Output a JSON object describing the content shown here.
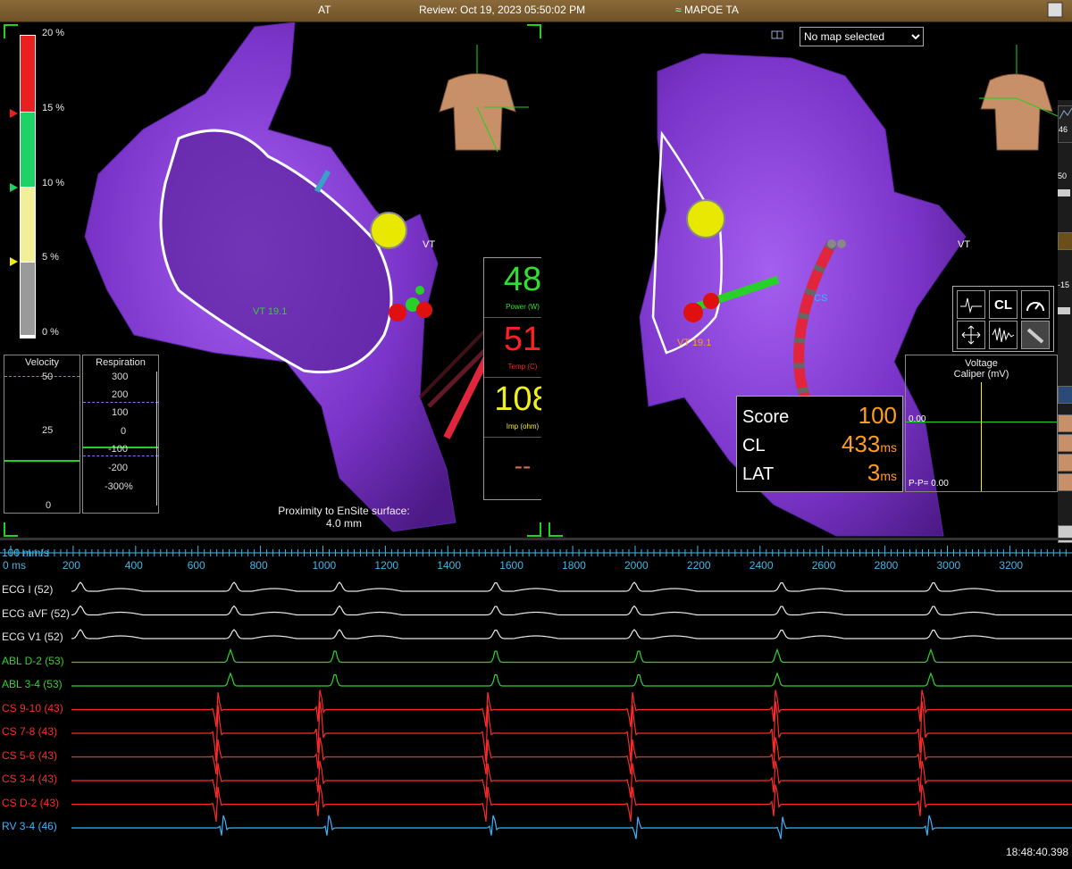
{
  "titlebar": {
    "left": "AT",
    "center": "Review: Oct 19, 2023 05:50:02 PM",
    "right": "MAPOE TA"
  },
  "map_selector": {
    "value": "No map selected",
    "options": [
      "No map selected"
    ]
  },
  "contact_scale": {
    "labels": [
      "20 %",
      "15 %",
      "10 %",
      "5 %",
      "0 %"
    ]
  },
  "velocity": {
    "title": "Velocity",
    "ticks": [
      "50",
      "25",
      "0"
    ]
  },
  "respiration": {
    "title": "Respiration",
    "ticks": [
      "300",
      "200",
      "100",
      "0",
      "-100",
      "-200",
      "-300%"
    ]
  },
  "map_left": {
    "label_vt": "VT",
    "label_vt19": "VT 19.1"
  },
  "map_right": {
    "label_vt": "VT",
    "label_vt19": "VT 19.1",
    "label_cs": "CS"
  },
  "ablation": {
    "power": {
      "value": "48",
      "label": "Power (W)"
    },
    "temp": {
      "value": "51",
      "label": "Temp (C)"
    },
    "imp": {
      "value": "108",
      "label": "Imp (ohm)"
    },
    "extra": "--"
  },
  "proximity": {
    "line1": "Proximity to EnSite surface:",
    "line2": "4.0 mm"
  },
  "score_panel": {
    "score_label": "Score",
    "score_value": "100",
    "cl_label": "CL",
    "cl_value": "433",
    "cl_unit": "ms",
    "lat_label": "LAT",
    "lat_value": "3",
    "lat_unit": "ms"
  },
  "voltage_panel": {
    "title": "Voltage",
    "subtitle": "Caliper (mV)",
    "zero": "0.00",
    "pp": "P-P= 0.00"
  },
  "tool_icons": {
    "cl": "CL"
  },
  "side_panel": {
    "val1": "46",
    "val2": "50",
    "val3": "-15"
  },
  "timeline": {
    "speed": "100 mm/s",
    "zero": "0 ms",
    "ticks": [
      "200",
      "400",
      "600",
      "800",
      "1000",
      "1200",
      "1400",
      "1600",
      "1800",
      "2000",
      "2200",
      "2400",
      "2600",
      "2800",
      "3000",
      "3200"
    ]
  },
  "traces": [
    {
      "label": "ECG I (52)",
      "color": "#e8e8e8"
    },
    {
      "label": "ECG aVF (52)",
      "color": "#e8e8e8"
    },
    {
      "label": "ECG V1 (52)",
      "color": "#e8e8e8"
    },
    {
      "label": "ABL  D-2 (53)",
      "color": "#2fd22f"
    },
    {
      "label": "ABL  3-4 (53)",
      "color": "#2fd22f"
    },
    {
      "label": "CS  9-10 (43)",
      "color": "#ff2a2a"
    },
    {
      "label": "CS  7-8 (43)",
      "color": "#ff2a2a"
    },
    {
      "label": "CS  5-6 (43)",
      "color": "#ff2a2a"
    },
    {
      "label": "CS  3-4 (43)",
      "color": "#ff2a2a"
    },
    {
      "label": "CS  D-2 (43)",
      "color": "#ff2a2a"
    },
    {
      "label": "RV  3-4 (46)",
      "color": "#3ab4ff"
    }
  ],
  "clock": "18:48:40.398",
  "colors": {
    "chamber": "#8a3fd6",
    "accent_green": "#1ed21e",
    "ecg_white": "#e8e8e8",
    "abl_green": "#2fd22f",
    "cs_red": "#ff2a2a",
    "rv_blue": "#3ab4ff",
    "score_orange": "#ff9d1f"
  }
}
